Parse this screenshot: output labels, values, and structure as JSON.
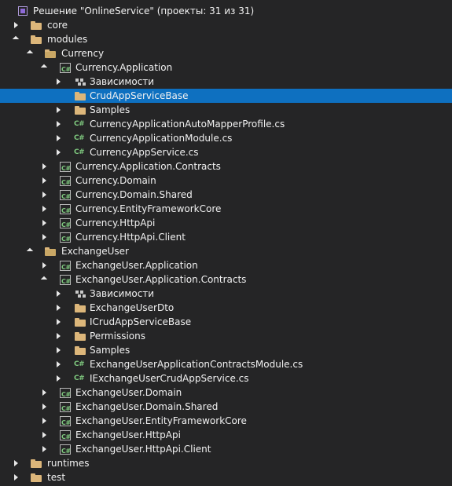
{
  "solution": "Решение \"OnlineService\" (проекты: 31 из 31)",
  "rows": [
    {
      "label": "core",
      "type": "folder",
      "depth": 0,
      "arrow": "collapsed",
      "name": "folder-core"
    },
    {
      "label": "modules",
      "type": "folder",
      "depth": 0,
      "arrow": "expanded",
      "name": "folder-modules"
    },
    {
      "label": "Currency",
      "type": "folder-open",
      "depth": 1,
      "arrow": "expanded",
      "name": "folder-currency"
    },
    {
      "label": "Currency.Application",
      "type": "project",
      "depth": 2,
      "arrow": "expanded",
      "name": "project-currency-application"
    },
    {
      "label": "Зависимости",
      "type": "deps",
      "depth": 3,
      "arrow": "collapsed",
      "name": "dependencies-node"
    },
    {
      "label": "CrudAppServiceBase",
      "type": "folder",
      "depth": 3,
      "arrow": "none",
      "name": "folder-crudappservicebase",
      "selected": true
    },
    {
      "label": "Samples",
      "type": "folder",
      "depth": 3,
      "arrow": "collapsed",
      "name": "folder-samples"
    },
    {
      "label": "CurrencyApplicationAutoMapperProfile.cs",
      "type": "cs",
      "depth": 3,
      "arrow": "collapsed",
      "name": "file-automapperprofile"
    },
    {
      "label": "CurrencyApplicationModule.cs",
      "type": "cs",
      "depth": 3,
      "arrow": "collapsed",
      "name": "file-applicationmodule"
    },
    {
      "label": "CurrencyAppService.cs",
      "type": "cs",
      "depth": 3,
      "arrow": "collapsed",
      "name": "file-currencyappservice"
    },
    {
      "label": "Currency.Application.Contracts",
      "type": "project",
      "depth": 2,
      "arrow": "collapsed",
      "name": "project-currency-application-contracts"
    },
    {
      "label": "Currency.Domain",
      "type": "project",
      "depth": 2,
      "arrow": "collapsed",
      "name": "project-currency-domain"
    },
    {
      "label": "Currency.Domain.Shared",
      "type": "project",
      "depth": 2,
      "arrow": "collapsed",
      "name": "project-currency-domain-shared"
    },
    {
      "label": "Currency.EntityFrameworkCore",
      "type": "project",
      "depth": 2,
      "arrow": "collapsed",
      "name": "project-currency-efcore"
    },
    {
      "label": "Currency.HttpApi",
      "type": "project",
      "depth": 2,
      "arrow": "collapsed",
      "name": "project-currency-httpapi"
    },
    {
      "label": "Currency.HttpApi.Client",
      "type": "project",
      "depth": 2,
      "arrow": "collapsed",
      "name": "project-currency-httpapi-client"
    },
    {
      "label": "ExchangeUser",
      "type": "folder-open",
      "depth": 1,
      "arrow": "expanded",
      "name": "folder-exchangeuser"
    },
    {
      "label": "ExchangeUser.Application",
      "type": "project",
      "depth": 2,
      "arrow": "collapsed",
      "name": "project-exchangeuser-application"
    },
    {
      "label": "ExchangeUser.Application.Contracts",
      "type": "project",
      "depth": 2,
      "arrow": "expanded",
      "name": "project-exchangeuser-application-contracts"
    },
    {
      "label": "Зависимости",
      "type": "deps",
      "depth": 3,
      "arrow": "collapsed",
      "name": "dependencies-node"
    },
    {
      "label": "ExchangeUserDto",
      "type": "folder",
      "depth": 3,
      "arrow": "collapsed",
      "name": "folder-exchangeuserdto"
    },
    {
      "label": "ICrudAppServiceBase",
      "type": "folder",
      "depth": 3,
      "arrow": "collapsed",
      "name": "folder-icrudappservicebase"
    },
    {
      "label": "Permissions",
      "type": "folder",
      "depth": 3,
      "arrow": "collapsed",
      "name": "folder-permissions"
    },
    {
      "label": "Samples",
      "type": "folder",
      "depth": 3,
      "arrow": "collapsed",
      "name": "folder-samples"
    },
    {
      "label": "ExchangeUserApplicationContractsModule.cs",
      "type": "cs",
      "depth": 3,
      "arrow": "collapsed",
      "name": "file-contractsmodule"
    },
    {
      "label": "IExchangeUserCrudAppService.cs",
      "type": "cs",
      "depth": 3,
      "arrow": "collapsed",
      "name": "file-iexchangeusercrudappservice"
    },
    {
      "label": "ExchangeUser.Domain",
      "type": "project",
      "depth": 2,
      "arrow": "collapsed",
      "name": "project-exchangeuser-domain"
    },
    {
      "label": "ExchangeUser.Domain.Shared",
      "type": "project",
      "depth": 2,
      "arrow": "collapsed",
      "name": "project-exchangeuser-domain-shared"
    },
    {
      "label": "ExchangeUser.EntityFrameworkCore",
      "type": "project",
      "depth": 2,
      "arrow": "collapsed",
      "name": "project-exchangeuser-efcore"
    },
    {
      "label": "ExchangeUser.HttpApi",
      "type": "project",
      "depth": 2,
      "arrow": "collapsed",
      "name": "project-exchangeuser-httpapi"
    },
    {
      "label": "ExchangeUser.HttpApi.Client",
      "type": "project",
      "depth": 2,
      "arrow": "collapsed",
      "name": "project-exchangeuser-httpapi-client"
    },
    {
      "label": "runtimes",
      "type": "folder",
      "depth": 0,
      "arrow": "collapsed",
      "name": "folder-runtimes"
    },
    {
      "label": "test",
      "type": "folder",
      "depth": 0,
      "arrow": "collapsed",
      "name": "folder-test"
    }
  ],
  "icons": {
    "project": "C#",
    "cs": "C#"
  }
}
